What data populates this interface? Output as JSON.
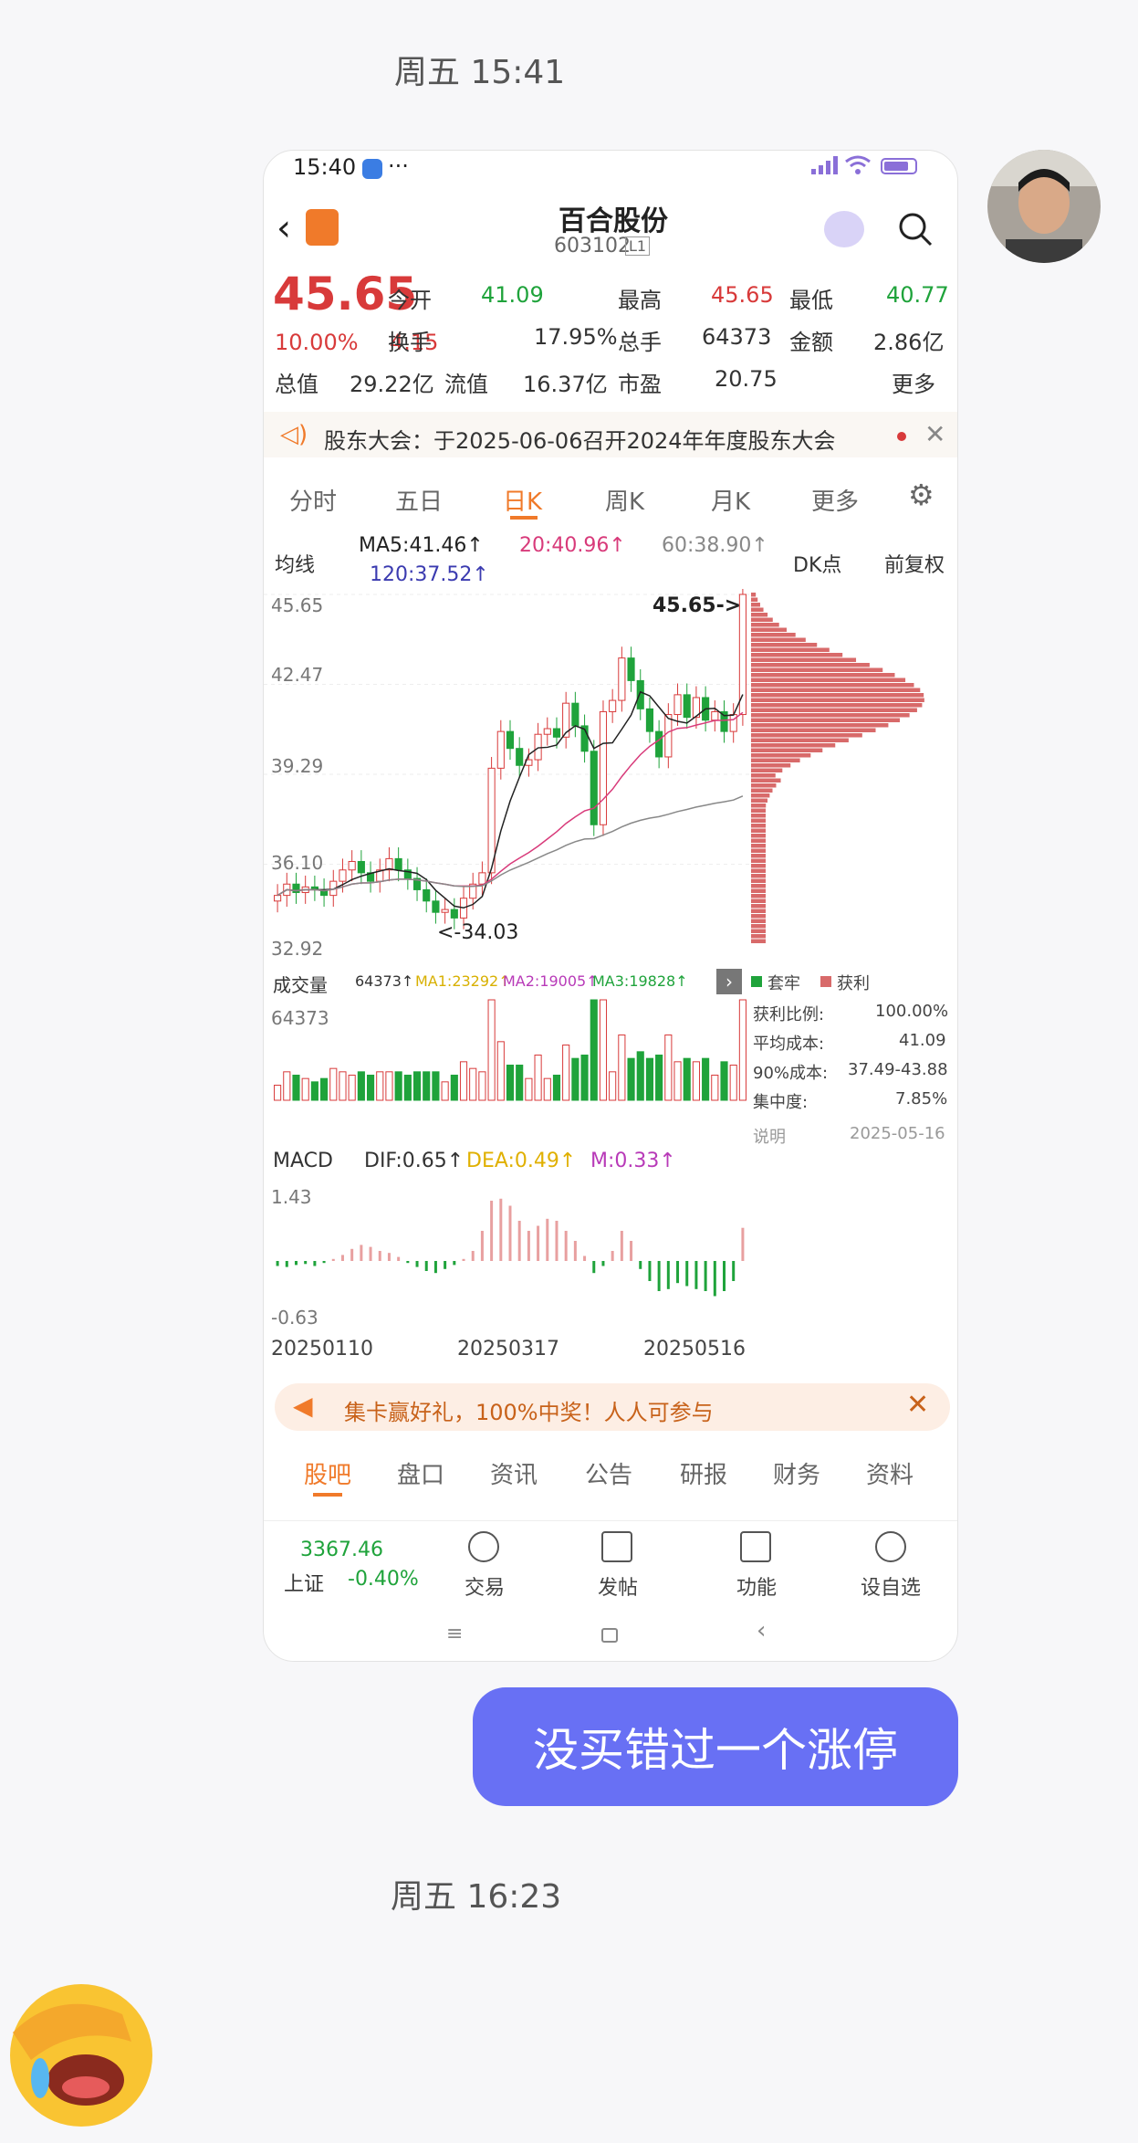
{
  "chat": {
    "timestamp1": "周五 15:41",
    "timestamp2": "周五 16:23",
    "message": "没买错过一个涨停"
  },
  "phone": {
    "status_time": "15:40",
    "status_dots": "···",
    "stock_name": "百合股份",
    "stock_code": "603102",
    "level_badge": "L1",
    "price": "45.65",
    "pct": "10.00%",
    "chg": "4.15",
    "quote": [
      {
        "label": "今开",
        "value": "41.09"
      },
      {
        "label": "最高",
        "value": "45.65"
      },
      {
        "label": "最低",
        "value": "40.77"
      },
      {
        "label": "换手",
        "value": "17.95%"
      },
      {
        "label": "总手",
        "value": "64373"
      },
      {
        "label": "金额",
        "value": "2.86亿"
      },
      {
        "label": "总值",
        "value": "29.22亿"
      },
      {
        "label": "流值",
        "value": "16.37亿"
      },
      {
        "label": "市盈",
        "value": "20.75"
      },
      {
        "label": "更多",
        "value": ""
      }
    ],
    "notice": "股东大会：于2025-06-06召开2024年年度股东大会",
    "chart_tabs": [
      "分时",
      "五日",
      "日K",
      "周K",
      "月K",
      "更多"
    ],
    "active_tab": "日K",
    "ma_select": "均线",
    "ma_values": {
      "ma5": "MA5:41.46↑",
      "ma20": "20:40.96↑",
      "ma60": "60:38.90↑",
      "ma120": "120:37.52↑"
    },
    "dk_label": "DK点",
    "fq_label": "前复权",
    "price_axis": [
      "45.65",
      "42.47",
      "39.29",
      "36.10",
      "32.92"
    ],
    "last_price_tag": "45.65->",
    "low_tag": "<-34.03",
    "volume_label": "成交量",
    "volume_values": {
      "vol": "64373↑",
      "ma1": "MA1:23292↑",
      "ma2": "MA2:19005↑",
      "ma3": "MA3:19828↑"
    },
    "volume_axis_top": "64373",
    "macd_label": "MACD",
    "macd_values": {
      "dif": "DIF:0.65↑",
      "dea": "DEA:0.49↑",
      "m": "M:0.33↑"
    },
    "macd_axis": [
      "1.43",
      "-0.63"
    ],
    "dates": [
      "20250110",
      "20250317",
      "20250516"
    ],
    "chip_legend": {
      "trapped": "套牢",
      "profit": "获利"
    },
    "chip_stats": [
      {
        "label": "获利比例:",
        "value": "100.00%"
      },
      {
        "label": "平均成本:",
        "value": "41.09"
      },
      {
        "label": "90%成本:",
        "value": "37.49-43.88"
      },
      {
        "label": "集中度:",
        "value": "7.85%"
      }
    ],
    "chip_note": "说明",
    "chip_date": "2025-05-16",
    "promo": "集卡赢好礼，100%中奖！人人可参与",
    "bottom_tabs": [
      "股吧",
      "盘口",
      "资讯",
      "公告",
      "研报",
      "财务",
      "资料"
    ],
    "index": {
      "value": "3367.46",
      "name": "上证",
      "pct": "-0.40%"
    },
    "toolbar": [
      "交易",
      "发帖",
      "功能",
      "设自选"
    ],
    "colors": {
      "up": "#d83a3a",
      "down": "#1fa33b",
      "accent": "#f07a2a",
      "bubble": "#6870f4"
    }
  },
  "chart_data": {
    "type": "candlestick",
    "x_start": "20250110",
    "x_mid": "20250317",
    "x_end": "20250516",
    "ylim": [
      32.92,
      45.65
    ],
    "close": [
      35.0,
      35.4,
      35.1,
      35.3,
      35.2,
      35.0,
      35.5,
      35.9,
      36.2,
      35.8,
      35.5,
      35.9,
      36.3,
      35.9,
      35.6,
      35.2,
      34.8,
      34.4,
      34.5,
      34.2,
      34.9,
      35.4,
      35.8,
      39.5,
      40.8,
      40.2,
      39.6,
      39.8,
      40.7,
      40.9,
      40.6,
      41.8,
      41.0,
      40.1,
      37.5,
      41.5,
      41.9,
      43.4,
      42.6,
      41.6,
      40.8,
      39.9,
      41.4,
      42.1,
      41.3,
      42.0,
      41.2,
      41.5,
      40.8,
      41.4,
      45.65
    ],
    "macd_m": [
      -0.05,
      -0.06,
      -0.04,
      -0.03,
      -0.05,
      -0.02,
      0.02,
      0.06,
      0.12,
      0.16,
      0.14,
      0.1,
      0.08,
      0.04,
      -0.02,
      -0.06,
      -0.1,
      -0.12,
      -0.08,
      -0.04,
      0.02,
      0.1,
      0.3,
      0.6,
      0.62,
      0.55,
      0.4,
      0.3,
      0.35,
      0.42,
      0.4,
      0.3,
      0.2,
      0.05,
      -0.12,
      -0.05,
      0.1,
      0.3,
      0.2,
      -0.08,
      -0.2,
      -0.3,
      -0.28,
      -0.22,
      -0.25,
      -0.28,
      -0.3,
      -0.35,
      -0.3,
      -0.2,
      0.33
    ]
  }
}
